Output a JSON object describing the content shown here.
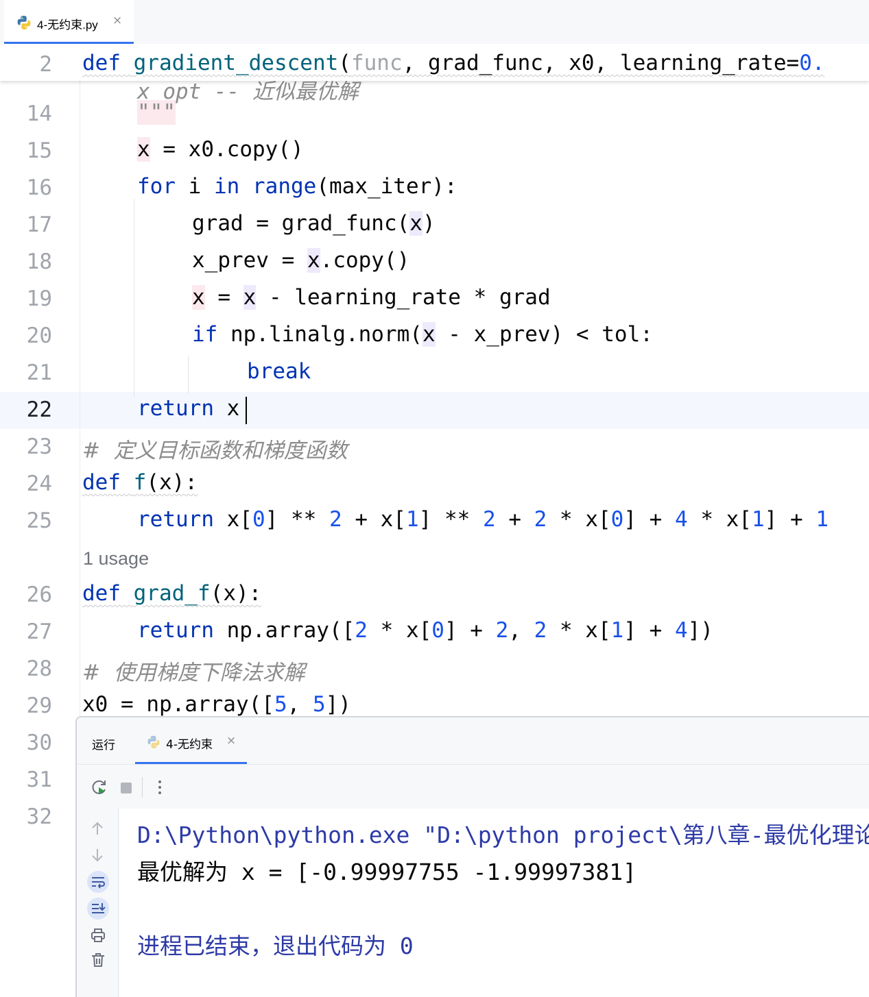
{
  "tab": {
    "filename": "4-无约束.py",
    "close": "×"
  },
  "sticky": {
    "line_no": "2",
    "def_kw": "def",
    "fn": "gradient_descent",
    "open": "(",
    "p1": "func",
    "rest": ", grad_func, x0, learning_rate=",
    "num": "0."
  },
  "lines": {
    "n14": "14",
    "n15": "15",
    "n16": "16",
    "n17": "17",
    "n18": "18",
    "n19": "19",
    "n20": "20",
    "n21": "21",
    "n22": "22",
    "n23": "23",
    "n24": "24",
    "n25": "25",
    "n26": "26",
    "n27": "27",
    "n28": "28",
    "n29": "29",
    "n30": "30",
    "n31": "31",
    "n32": "32"
  },
  "code": {
    "l14_doc": "\"\"\"",
    "l15_x": "x",
    "l15_rest": " = x0.copy()",
    "l16_for": "for",
    "l16_i": " i ",
    "l16_in": "in",
    "l16_sp": " ",
    "l16_range": "range",
    "l16_rest": "(max_iter):",
    "l17_a": "grad = grad_func(",
    "l17_x": "x",
    "l17_b": ")",
    "l18_a": "x_prev = ",
    "l18_x": "x",
    "l18_b": ".copy()",
    "l19_x1": "x",
    "l19_eq": " = ",
    "l19_x2": "x",
    "l19_b": " - learning_rate * grad",
    "l20_if": "if",
    "l20_a": " np.linalg.norm(",
    "l20_x": "x",
    "l20_b": " - x_prev) < tol:",
    "l21_break": "break",
    "l22_return": "return",
    "l22_x": " x",
    "l23_comment": "#  定义目标函数和梯度函数",
    "l24_def": "def",
    "l24_f": "f",
    "l24_rest": "(x):",
    "l25_return": "return",
    "l25_parts": [
      " x[",
      "0",
      "] ** ",
      "2",
      " + x[",
      "1",
      "] ** ",
      "2",
      " + ",
      "2",
      " * x[",
      "0",
      "] + ",
      "4",
      " * x[",
      "1",
      "] + ",
      "1"
    ],
    "usage": "1 usage",
    "l26_def": "def",
    "l26_f": "grad_f",
    "l26_rest": "(x):",
    "l27_return": "return",
    "l27_parts": [
      " np.array([",
      "2",
      " * x[",
      "0",
      "] + ",
      "2",
      ", ",
      "2",
      " * x[",
      "1",
      "] + ",
      "4",
      "])"
    ],
    "l28_comment": "#  使用梯度下降法求解",
    "l29_parts": [
      "x0 = np.array([",
      "5",
      ", ",
      "5",
      "])"
    ],
    "l13_partial": "x_opt -- 近似最优解"
  },
  "run": {
    "label": "运行",
    "tab": "4-无约束",
    "close": "×",
    "output": [
      "D:\\Python\\python.exe \"D:\\python project\\第八章-最优化理论",
      "最优解为 x = [-0.99997755 -1.99997381]",
      "",
      "进程已结束，退出代码为 0"
    ]
  },
  "colors": {
    "keyword": "#0033b3",
    "function": "#00627a",
    "number": "#1750eb",
    "accent": "#3574f0",
    "console_path": "#2d3aa6"
  },
  "icons": [
    "python-file-icon",
    "rerun-icon",
    "stop-icon",
    "more-icon",
    "scroll-up-icon",
    "scroll-down-icon",
    "soft-wrap-icon",
    "scroll-to-end-icon",
    "print-icon",
    "trash-icon"
  ]
}
